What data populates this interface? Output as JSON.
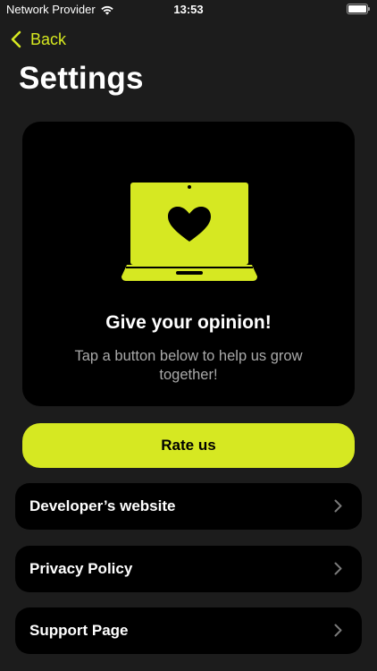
{
  "status_bar": {
    "carrier": "Network Provider",
    "time": "13:53",
    "battery_level": 1.0
  },
  "nav": {
    "back_label": "Back",
    "title": "Settings"
  },
  "card": {
    "heading": "Give your opinion!",
    "subtitle": "Tap a button below to help us grow together!",
    "icon": "laptop-heart-icon"
  },
  "rate_button": {
    "label": "Rate us"
  },
  "links": [
    {
      "label": "Developer’s website"
    },
    {
      "label": "Privacy Policy"
    },
    {
      "label": "Support Page"
    }
  ],
  "colors": {
    "accent": "#d6e822",
    "background": "#1c1c1c",
    "card": "#000000",
    "secondary_text": "#a9a9a9"
  }
}
